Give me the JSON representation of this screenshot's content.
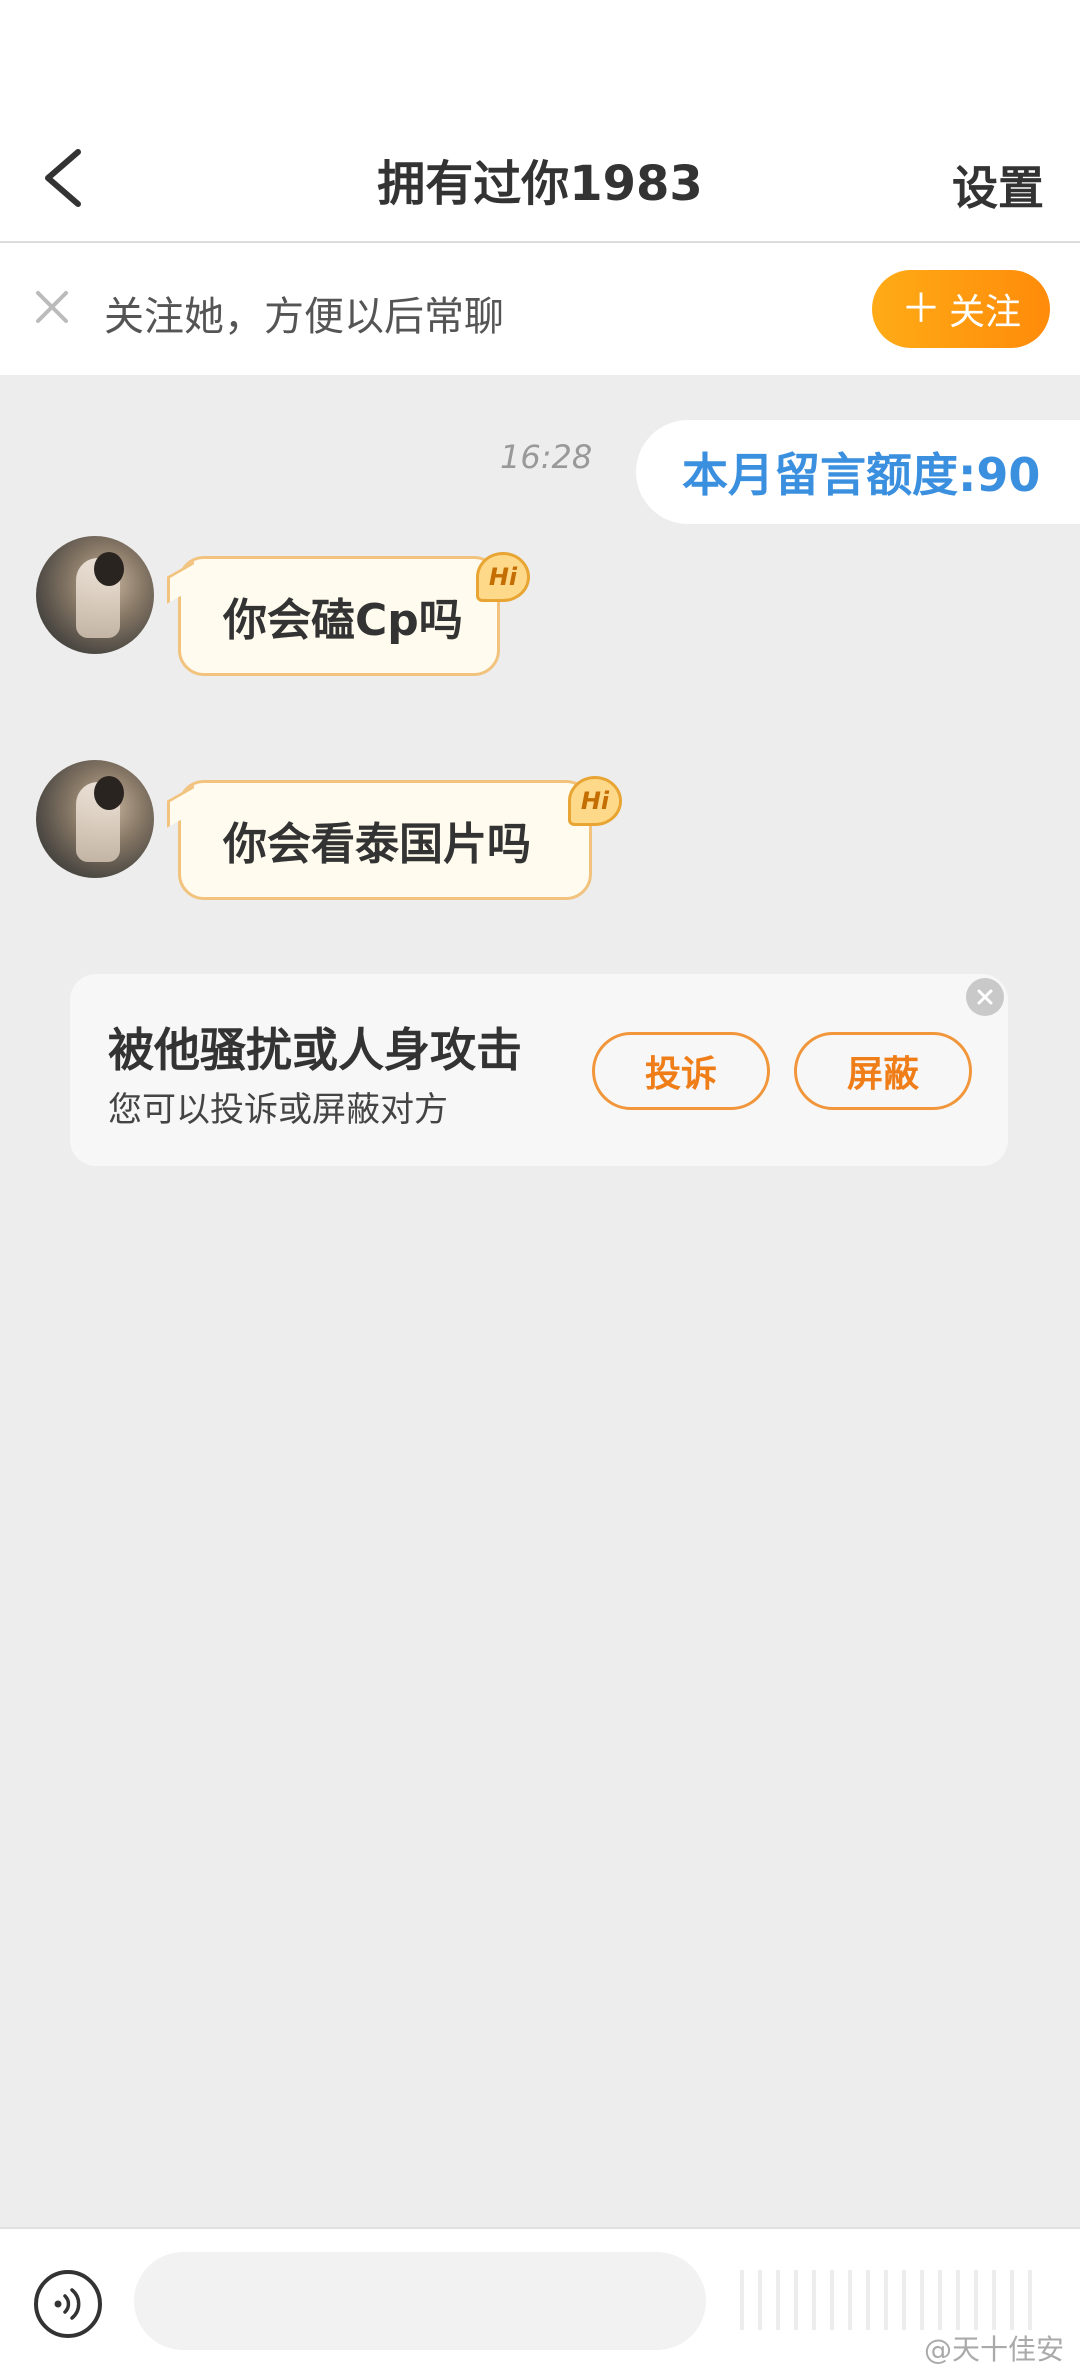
{
  "header": {
    "title": "拥有过你1983",
    "settings_label": "设置"
  },
  "follow_banner": {
    "text": "关注她，方便以后常聊",
    "button_label": "关注"
  },
  "chat": {
    "timestamp": "16:28",
    "quota_text": "本月留言额度:90",
    "messages": [
      {
        "text": "你会磕Cp吗",
        "badge": "Hi"
      },
      {
        "text": "你会看泰国片吗",
        "badge": "Hi"
      }
    ]
  },
  "report_card": {
    "title": "被他骚扰或人身攻击",
    "subtitle": "您可以投诉或屏蔽对方",
    "complain_label": "投诉",
    "block_label": "屏蔽"
  },
  "input": {
    "placeholder": ""
  },
  "watermark": "@天十佳安",
  "colors": {
    "accent": "#ff9d12",
    "link_blue": "#3b8fdf",
    "bubble_border": "#f1c37e",
    "background": "#ededed"
  }
}
